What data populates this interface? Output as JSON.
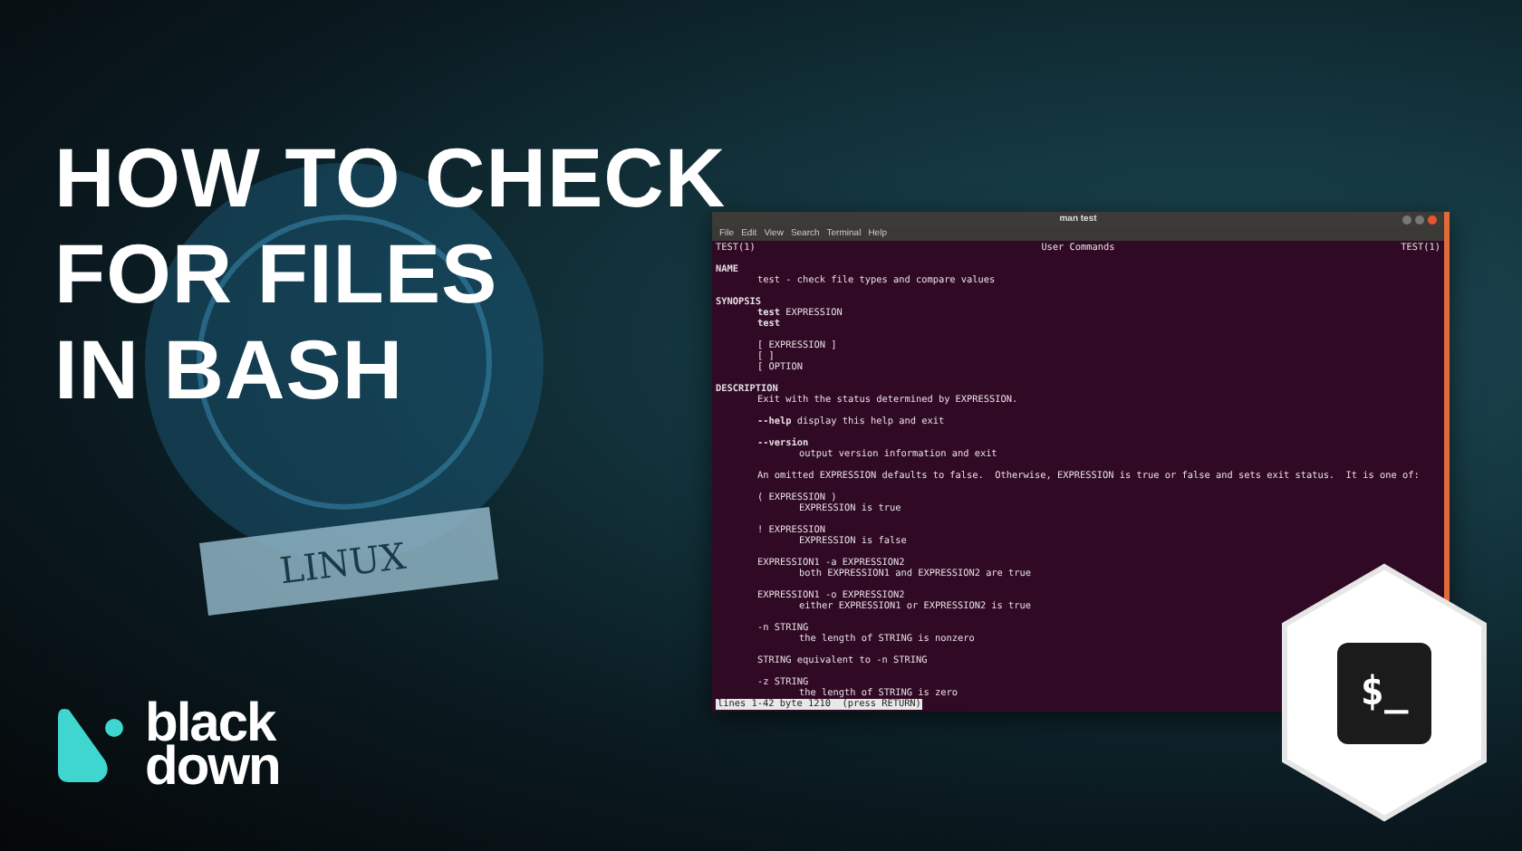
{
  "headline": [
    "HOW TO CHECK",
    "FOR FILES",
    "IN BASH"
  ],
  "artwork": {
    "ribbon": "LINUX"
  },
  "terminal": {
    "title": "man test",
    "menu": [
      "File",
      "Edit",
      "View",
      "Search",
      "Terminal",
      "Help"
    ],
    "header": {
      "left": "TEST(1)",
      "center": "User Commands",
      "right": "TEST(1)"
    },
    "blocks": [
      {
        "lines": [
          {
            "kind": "section",
            "text": "NAME"
          },
          {
            "kind": "body",
            "text": "test - check file types and compare values"
          }
        ]
      },
      {
        "lines": [
          {
            "kind": "section",
            "text": "SYNOPSIS"
          },
          {
            "kind": "body",
            "text": "**test** EXPRESSION"
          },
          {
            "kind": "body",
            "text": "**test**"
          }
        ]
      },
      {
        "lines": [
          {
            "kind": "body",
            "text": "[ EXPRESSION ]"
          },
          {
            "kind": "body",
            "text": "[ ]"
          },
          {
            "kind": "body",
            "text": "[ OPTION"
          }
        ]
      },
      {
        "lines": [
          {
            "kind": "section",
            "text": "DESCRIPTION"
          },
          {
            "kind": "body",
            "text": "Exit with the status determined by EXPRESSION."
          }
        ]
      },
      {
        "lines": [
          {
            "kind": "body",
            "text": "**--help** display this help and exit"
          }
        ]
      },
      {
        "lines": [
          {
            "kind": "body",
            "text": "**--version**"
          },
          {
            "kind": "detail",
            "text": "output version information and exit"
          }
        ]
      },
      {
        "lines": [
          {
            "kind": "body",
            "text": "An omitted EXPRESSION defaults to false.  Otherwise, EXPRESSION is true or false and sets exit status.  It is one of:"
          }
        ]
      },
      {
        "lines": [
          {
            "kind": "body",
            "text": "( EXPRESSION )"
          },
          {
            "kind": "detail",
            "text": "EXPRESSION is true"
          }
        ]
      },
      {
        "lines": [
          {
            "kind": "body",
            "text": "! EXPRESSION"
          },
          {
            "kind": "detail",
            "text": "EXPRESSION is false"
          }
        ]
      },
      {
        "lines": [
          {
            "kind": "body",
            "text": "EXPRESSION1 -a EXPRESSION2"
          },
          {
            "kind": "detail",
            "text": "both EXPRESSION1 and EXPRESSION2 are true"
          }
        ]
      },
      {
        "lines": [
          {
            "kind": "body",
            "text": "EXPRESSION1 -o EXPRESSION2"
          },
          {
            "kind": "detail",
            "text": "either EXPRESSION1 or EXPRESSION2 is true"
          }
        ]
      },
      {
        "lines": [
          {
            "kind": "body",
            "text": "-n STRING"
          },
          {
            "kind": "detail",
            "text": "the length of STRING is nonzero"
          }
        ]
      },
      {
        "lines": [
          {
            "kind": "body",
            "text": "STRING equivalent to -n STRING"
          }
        ]
      },
      {
        "lines": [
          {
            "kind": "body",
            "text": "-z STRING"
          },
          {
            "kind": "detail",
            "text": "the length of STRING is zero"
          }
        ]
      }
    ],
    "status": "lines 1-42 byte 1210  (press RETURN)"
  },
  "bash_badge": {
    "prompt": "$_"
  },
  "logo": {
    "lines": [
      "black",
      "down"
    ]
  }
}
